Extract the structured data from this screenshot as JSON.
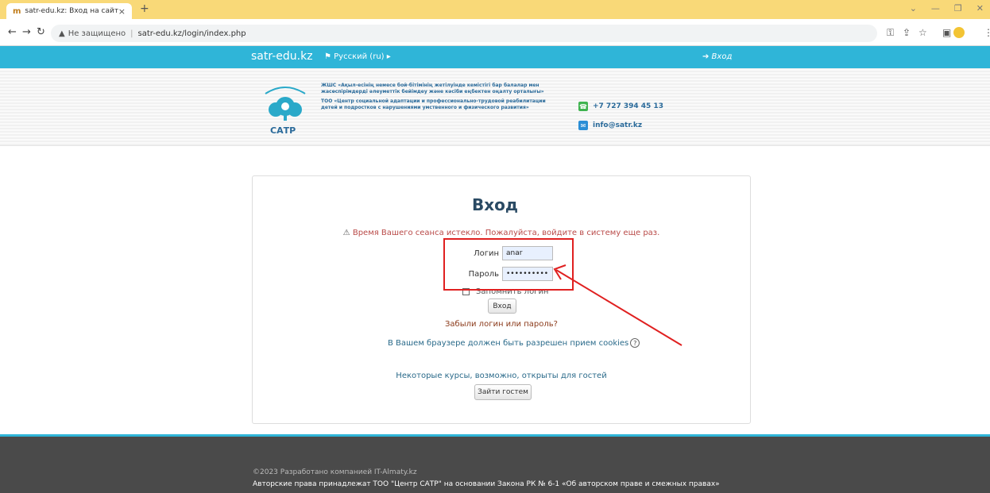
{
  "browser": {
    "tab_title": "satr-edu.kz: Вход на сайт",
    "tab_close": "×",
    "new_tab": "+",
    "security_label": "Не защищено",
    "url": "satr-edu.kz/login/index.php"
  },
  "site_nav": {
    "brand": "satr-edu.kz",
    "language": "⚑ Русский (ru) ▸",
    "login_link": "➔ Вход"
  },
  "header": {
    "logo_text": "САТР",
    "description_kz": "ЖШС «Ақыл-есінің немесе бой-бітімінің жетілуінде кемістігі бар балалар мен жасөспірімдерді әлеуметтік бейімдеу және кәсіби еңбектен оңалту орталығы»",
    "description_ru": "ТОО «Центр социальной адаптации и профессионально-трудовой реабилитации детей и подростков с нарушениями умственного и физического развития»",
    "phone": "+7 727 394 45 13",
    "email": "info@satr.kz"
  },
  "login": {
    "title": "Вход",
    "session_expired": "Время Вашего сеанса истекло. Пожалуйста, войдите в систему еще раз.",
    "username_label": "Логин",
    "username_value": "anar",
    "password_label": "Пароль",
    "password_value": "•••••••••••",
    "remember_label": "Запомнить логин",
    "submit_label": "Вход",
    "forgot_link": "Забыли логин или пароль?",
    "cookies_notice": "В Вашем браузере должен быть разрешен прием cookies",
    "guests_notice": "Некоторые курсы, возможно, открыты для гостей",
    "guest_button": "Зайти гостем"
  },
  "footer": {
    "copyright": "©2023 Разработано компанией IT-Almaty.kz",
    "rights": "Авторские права принадлежат ТОО \"Центр САТР\" на основании Закона РК № 6-1 «Об авторском праве и смежных правах»"
  },
  "colors": {
    "accent": "#2fb5d8",
    "annotation": "#e02020",
    "tabstrip": "#f9d978",
    "footer": "#4a4a4a"
  }
}
